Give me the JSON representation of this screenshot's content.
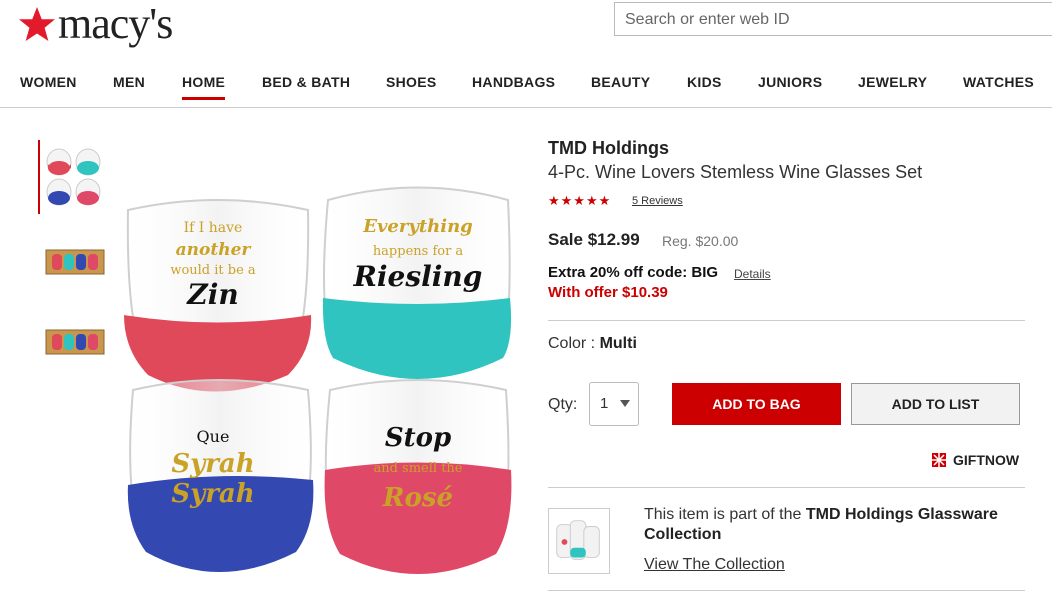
{
  "header": {
    "logo_text": "macy's",
    "search_placeholder": "Search or enter web ID"
  },
  "nav": {
    "items": [
      "WOMEN",
      "MEN",
      "HOME",
      "BED & BATH",
      "SHOES",
      "HANDBAGS",
      "BEAUTY",
      "KIDS",
      "JUNIORS",
      "JEWELRY",
      "WATCHES"
    ],
    "active": "HOME"
  },
  "gallery": {
    "glass_texts": {
      "g1": [
        "If I have",
        "another",
        "would it be a",
        "Zin"
      ],
      "g2": [
        "Everything",
        "happens for a",
        "Riesling"
      ],
      "g3": [
        "Que",
        "Syrah",
        "Syrah"
      ],
      "g4": [
        "Stop",
        "and smell the",
        "Rosé"
      ]
    }
  },
  "product": {
    "brand": "TMD Holdings",
    "name": "4-Pc. Wine Lovers Stemless Wine Glasses Set",
    "stars": "★★★★★",
    "rating": 5,
    "reviews_link": "5 Reviews",
    "sale_price": "Sale $12.99",
    "reg_price": "Reg. $20.00",
    "extra_offer": "Extra 20% off code: BIG",
    "details_link": "Details",
    "with_offer": "With offer $10.39",
    "color_label": "Color :",
    "color_value": "Multi",
    "qty_label": "Qty:",
    "qty_value": "1",
    "add_to_bag": "ADD TO BAG",
    "add_to_list": "ADD TO LIST",
    "giftnow": "GIFTNOW"
  },
  "collection": {
    "text_prefix": "This item is part of the",
    "collection_name": "TMD Holdings Glassware Collection",
    "link": "View The Collection"
  },
  "colors": {
    "brand_red": "#cc0000",
    "glass_red": "#e0495a",
    "glass_teal": "#2fc4c0",
    "glass_blue": "#3348b0",
    "glass_pink": "#e04868",
    "gold": "#c9a227"
  },
  "icons": [
    "macys-star-icon",
    "search-icon",
    "chevron-down-icon",
    "gift-icon",
    "rating-stars-icon"
  ]
}
